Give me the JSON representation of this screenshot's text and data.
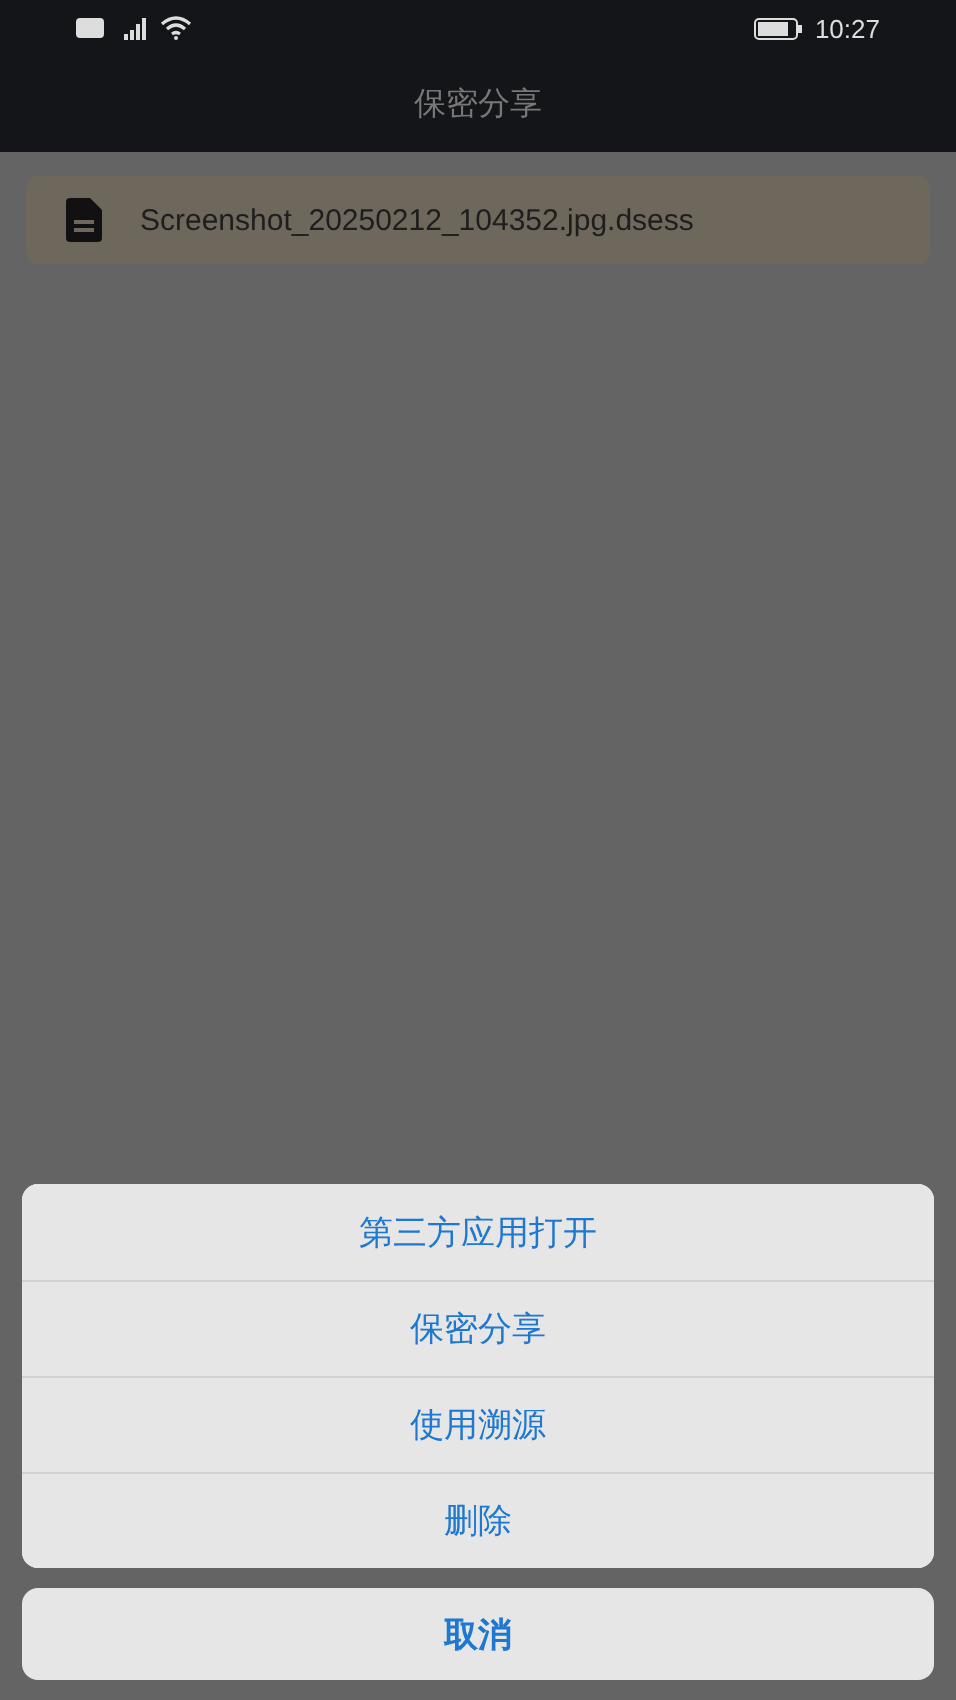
{
  "status_bar": {
    "time": "10:27"
  },
  "header": {
    "title": "保密分享"
  },
  "files": [
    {
      "name": "Screenshot_20250212_104352.jpg.dsess"
    }
  ],
  "action_sheet": {
    "actions": [
      {
        "label": "第三方应用打开"
      },
      {
        "label": "保密分享"
      },
      {
        "label": "使用溯源"
      },
      {
        "label": "删除"
      }
    ],
    "cancel": "取消"
  }
}
